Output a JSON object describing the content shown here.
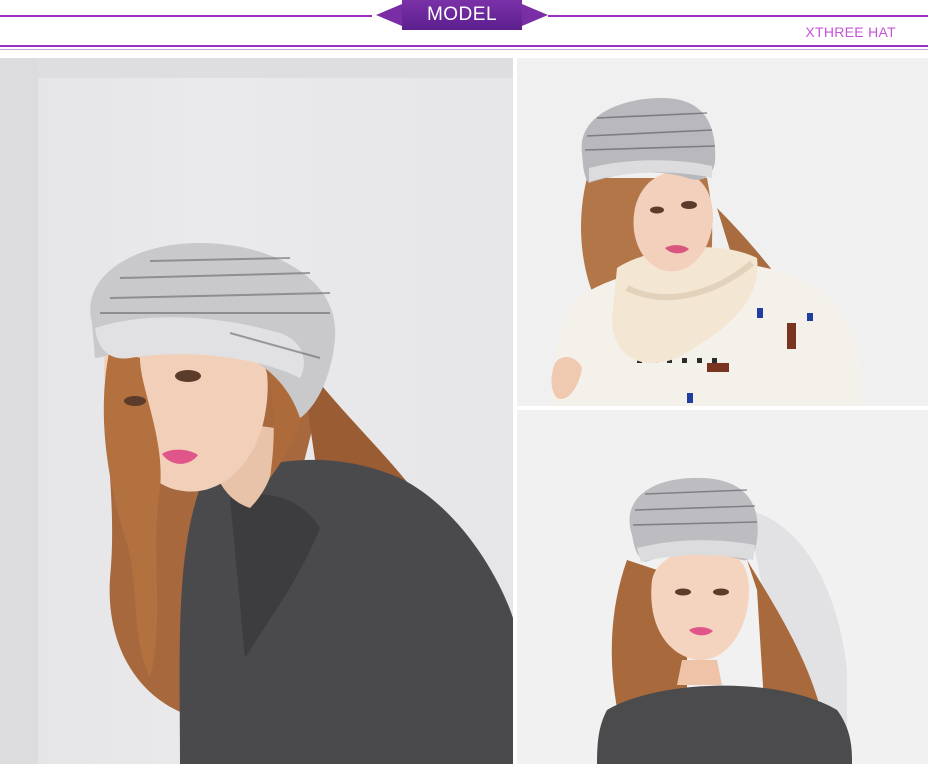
{
  "header": {
    "badge_label": "MODEL",
    "brand": "XTHREE HAT"
  },
  "colors": {
    "accent": "#9b2ec4",
    "badge": "#6a2699",
    "brand_text": "#c553d8"
  },
  "photos": [
    {
      "subject": "model wearing grey knit beret with dark sweater, side view"
    },
    {
      "subject": "model wearing grey knit beret with cream scarf and patterned sweater"
    },
    {
      "subject": "model wearing grey knit beanie with dark sweater, front view"
    }
  ]
}
